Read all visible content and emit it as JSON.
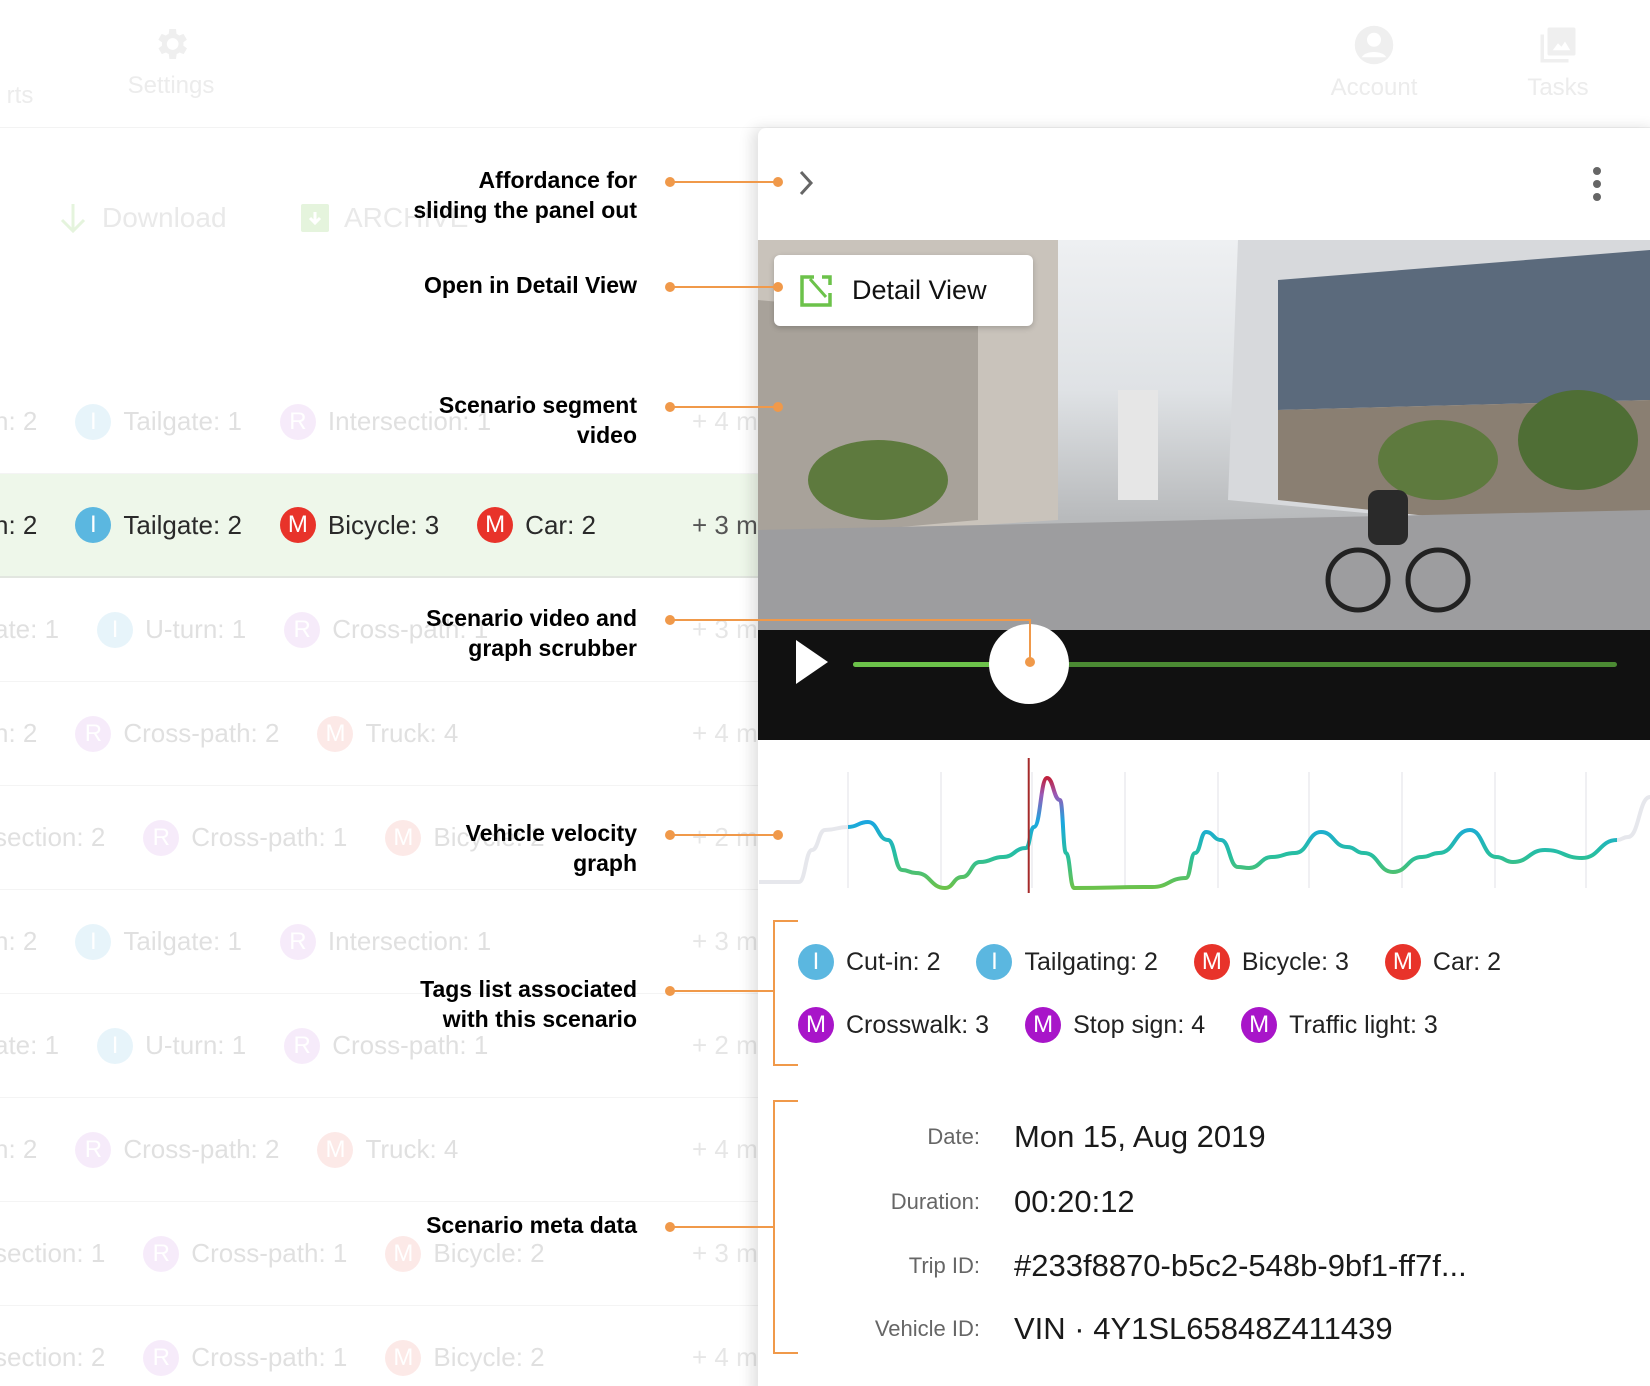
{
  "nav": {
    "items": [
      {
        "label": "rts",
        "icon": "reports-icon"
      },
      {
        "label": "Settings",
        "icon": "gear-icon"
      },
      {
        "label": "Account",
        "icon": "account-icon"
      },
      {
        "label": "Tasks",
        "icon": "tasks-icon"
      }
    ]
  },
  "toolbar": {
    "download": "Download",
    "archive": "ARCHIVE"
  },
  "list": {
    "rows": [
      {
        "lead": "n: 2",
        "chips": [
          {
            "t": "I",
            "label": "Tailgate: 1"
          },
          {
            "t": "R",
            "label": "Intersection: 1"
          }
        ],
        "more": "+ 4 m"
      },
      {
        "lead": "n: 2",
        "chips": [
          {
            "t": "I",
            "label": "Tailgate: 2"
          },
          {
            "t": "M",
            "label": "Bicycle: 3"
          },
          {
            "t": "M",
            "label": "Car: 2"
          }
        ],
        "more": "+ 3 m",
        "active": true
      },
      {
        "lead": "ate: 1",
        "chips": [
          {
            "t": "I",
            "label": "U-turn: 1"
          },
          {
            "t": "R",
            "label": "Cross-path: 1"
          }
        ],
        "more": "+ 3 m"
      },
      {
        "lead": "n: 2",
        "chips": [
          {
            "t": "R",
            "label": "Cross-path: 2"
          },
          {
            "t": "M",
            "label": "Truck: 4"
          }
        ],
        "more": "+ 4 m"
      },
      {
        "lead": "section: 2",
        "chips": [
          {
            "t": "R",
            "label": "Cross-path: 1"
          },
          {
            "t": "M",
            "label": "Bicycle: 2"
          }
        ],
        "more": "+ 2 m"
      },
      {
        "lead": "n: 2",
        "chips": [
          {
            "t": "I",
            "label": "Tailgate: 1"
          },
          {
            "t": "R",
            "label": "Intersection: 1"
          }
        ],
        "more": "+ 3 m"
      },
      {
        "lead": "ate: 1",
        "chips": [
          {
            "t": "I",
            "label": "U-turn: 1"
          },
          {
            "t": "R",
            "label": "Cross-path: 1"
          }
        ],
        "more": "+ 2 m"
      },
      {
        "lead": "n: 2",
        "chips": [
          {
            "t": "R",
            "label": "Cross-path: 2"
          },
          {
            "t": "M",
            "label": "Truck: 4"
          }
        ],
        "more": "+ 4 m"
      },
      {
        "lead": "section: 1",
        "chips": [
          {
            "t": "R",
            "label": "Cross-path: 1"
          },
          {
            "t": "M",
            "label": "Bicycle: 2"
          }
        ],
        "more": "+ 3 m"
      },
      {
        "lead": "section: 2",
        "chips": [
          {
            "t": "R",
            "label": "Cross-path: 1"
          },
          {
            "t": "M",
            "label": "Bicycle: 2"
          }
        ],
        "more": "+ 4 m"
      }
    ]
  },
  "badge_colors": {
    "I": "#5bb7e0",
    "M": "#e8332a",
    "R": "#a815c9"
  },
  "faded_badge_colors": {
    "I": "#5bb7e0",
    "M": "#f06a5f",
    "R": "#c77be0"
  },
  "panel": {
    "detail_view_label": "Detail View",
    "scrubber_progress": 0.23,
    "tags": [
      [
        {
          "t": "I",
          "label": "Cut-in: 2"
        },
        {
          "t": "I",
          "label": "Tailgating: 2"
        },
        {
          "t": "M",
          "label": "Bicycle: 3"
        },
        {
          "t": "M",
          "label": "Car: 2"
        }
      ],
      [
        {
          "t": "M",
          "label": "Crosswalk: 3"
        },
        {
          "t": "M",
          "label": "Stop sign: 4"
        },
        {
          "t": "M",
          "label": "Traffic light: 3"
        }
      ]
    ],
    "meta": [
      {
        "label": "Date:",
        "value": "Mon 15, Aug 2019"
      },
      {
        "label": "Duration:",
        "value": "00:20:12"
      },
      {
        "label": "Trip ID:",
        "value": "#233f8870-b5c2-548b-9bf1-ff7f..."
      },
      {
        "label": "Vehicle ID:",
        "value": "VIN · 4Y1SL65848Z411439"
      }
    ],
    "accent": "#6cc24a"
  },
  "tag_purple_override": "#a815c9",
  "annotations": [
    {
      "lines": [
        "Affordance for",
        "sliding the panel out"
      ]
    },
    {
      "lines": [
        "Open in Detail View"
      ]
    },
    {
      "lines": [
        "Scenario segment",
        "video"
      ]
    },
    {
      "lines": [
        "Scenario video and",
        "graph scrubber"
      ]
    },
    {
      "lines": [
        "Vehicle velocity",
        "graph"
      ]
    },
    {
      "lines": [
        "Tags list associated",
        "with this scenario"
      ]
    },
    {
      "lines": [
        "Scenario meta data"
      ]
    }
  ],
  "annotation_color": "#f0994a"
}
